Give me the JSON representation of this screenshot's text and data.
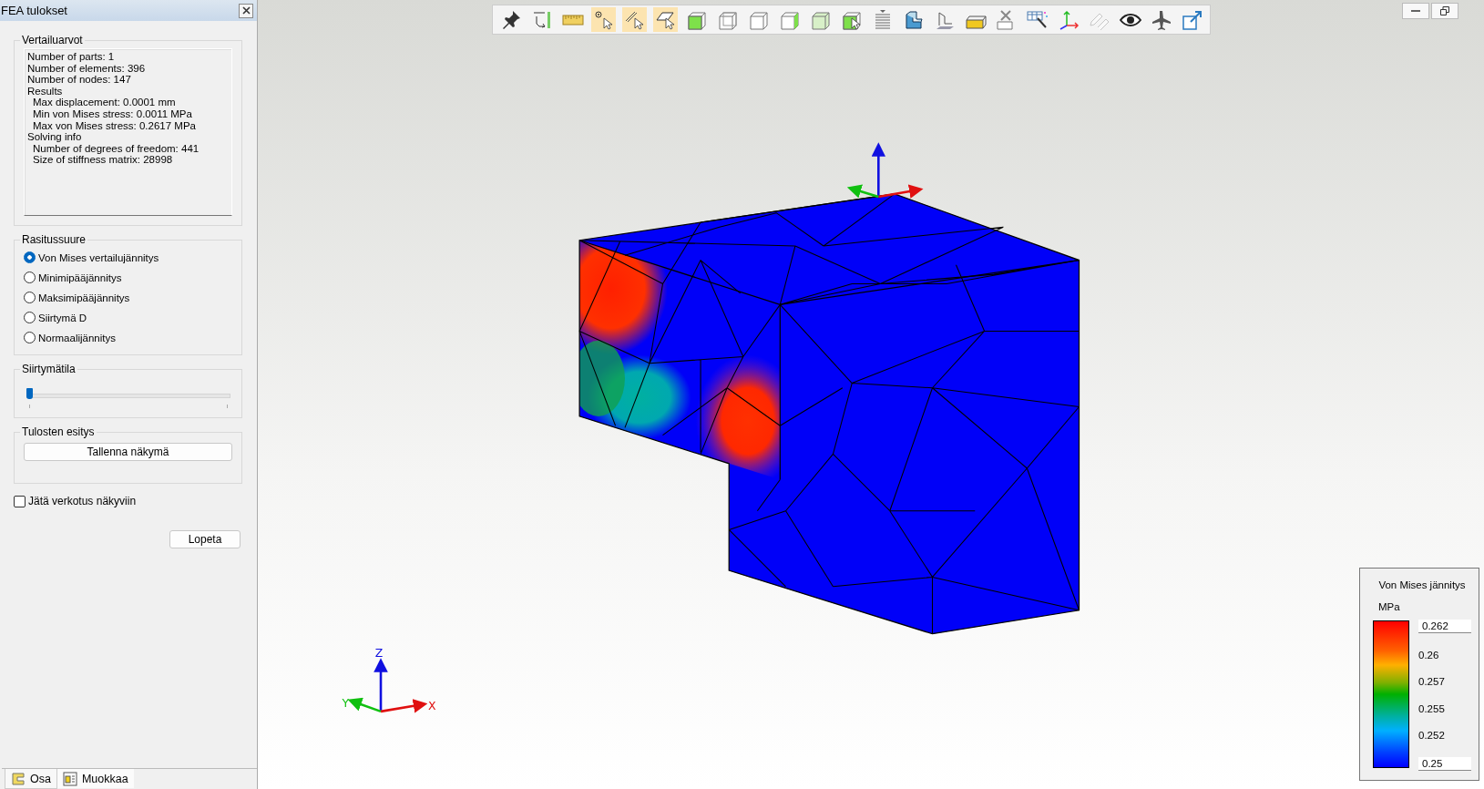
{
  "panel": {
    "title": "FEA tulokset"
  },
  "info": {
    "legend": "Vertailuarvot",
    "lines": [
      {
        "text": "Number of parts: 1"
      },
      {
        "text": "Number of elements: 396"
      },
      {
        "text": "Number of nodes: 147"
      },
      {
        "text": "Results",
        "children": [
          {
            "text": "Max displacement: 0.0001 mm"
          },
          {
            "text": "Min von Mises stress: 0.0011 MPa"
          },
          {
            "text": "Max von Mises stress: 0.2617 MPa"
          }
        ]
      },
      {
        "text": "Solving info",
        "children": [
          {
            "text": "Number of degrees of freedom: 441"
          },
          {
            "text": "Size of stiffness matrix: 28998"
          }
        ]
      }
    ]
  },
  "stress_type": {
    "legend": "Rasitussuure",
    "options": [
      {
        "label": "Von Mises vertailujännitys",
        "selected": true
      },
      {
        "label": "Minimipääjännitys",
        "selected": false
      },
      {
        "label": "Maksimipääjännitys",
        "selected": false
      },
      {
        "label": "Siirtymä D",
        "selected": false
      },
      {
        "label": "Normaalijännitys",
        "selected": false
      }
    ]
  },
  "mode_shape": {
    "legend": "Siirtymätila",
    "level": 0
  },
  "results_display": {
    "legend": "Tulosten esitys",
    "button": "Tallenna näkymä"
  },
  "show_mesh": {
    "label": "Jätä verkotus näkyviin",
    "checked": false
  },
  "quit_button": "Lopeta",
  "bottom_tabs": [
    {
      "label": "Osa",
      "selected": true
    },
    {
      "label": "Muokkaa",
      "selected": false
    }
  ],
  "toolbar": [
    {
      "kind": "pin",
      "selected": false,
      "disabled": false
    },
    {
      "kind": "rotate",
      "selected": false,
      "disabled": false
    },
    {
      "kind": "ruler",
      "selected": false,
      "disabled": false
    },
    {
      "kind": "point",
      "selected": true,
      "disabled": false
    },
    {
      "kind": "edge",
      "selected": true,
      "disabled": false
    },
    {
      "kind": "face",
      "selected": true,
      "disabled": false
    },
    {
      "kind": "cube1",
      "selected": false,
      "disabled": false
    },
    {
      "kind": "cube2",
      "selected": false,
      "disabled": false
    },
    {
      "kind": "cube3",
      "selected": false,
      "disabled": false
    },
    {
      "kind": "cube4",
      "selected": false,
      "disabled": false
    },
    {
      "kind": "cube5",
      "selected": false,
      "disabled": false
    },
    {
      "kind": "cube6",
      "selected": false,
      "disabled": false
    },
    {
      "kind": "list",
      "selected": false,
      "disabled": false
    },
    {
      "kind": "extrude",
      "selected": false,
      "disabled": false
    },
    {
      "kind": "sketch",
      "selected": false,
      "disabled": false
    },
    {
      "kind": "box",
      "selected": false,
      "disabled": false
    },
    {
      "kind": "delete",
      "selected": false,
      "disabled": false
    },
    {
      "kind": "wand",
      "selected": false,
      "disabled": false
    },
    {
      "kind": "axes",
      "selected": false,
      "disabled": false
    },
    {
      "kind": "pencil",
      "selected": false,
      "disabled": true
    },
    {
      "kind": "eye",
      "selected": false,
      "disabled": false
    },
    {
      "kind": "plane",
      "selected": false,
      "disabled": false
    },
    {
      "kind": "export",
      "selected": false,
      "disabled": false
    }
  ],
  "axes": {
    "z": "Z",
    "y": "Y",
    "x": "X"
  },
  "color_legend": {
    "title": "Von Mises jännitys",
    "unit": "MPa",
    "max": "0.262",
    "ticks": [
      "0.26",
      "0.257",
      "0.255",
      "0.252"
    ],
    "min": "0.25"
  }
}
